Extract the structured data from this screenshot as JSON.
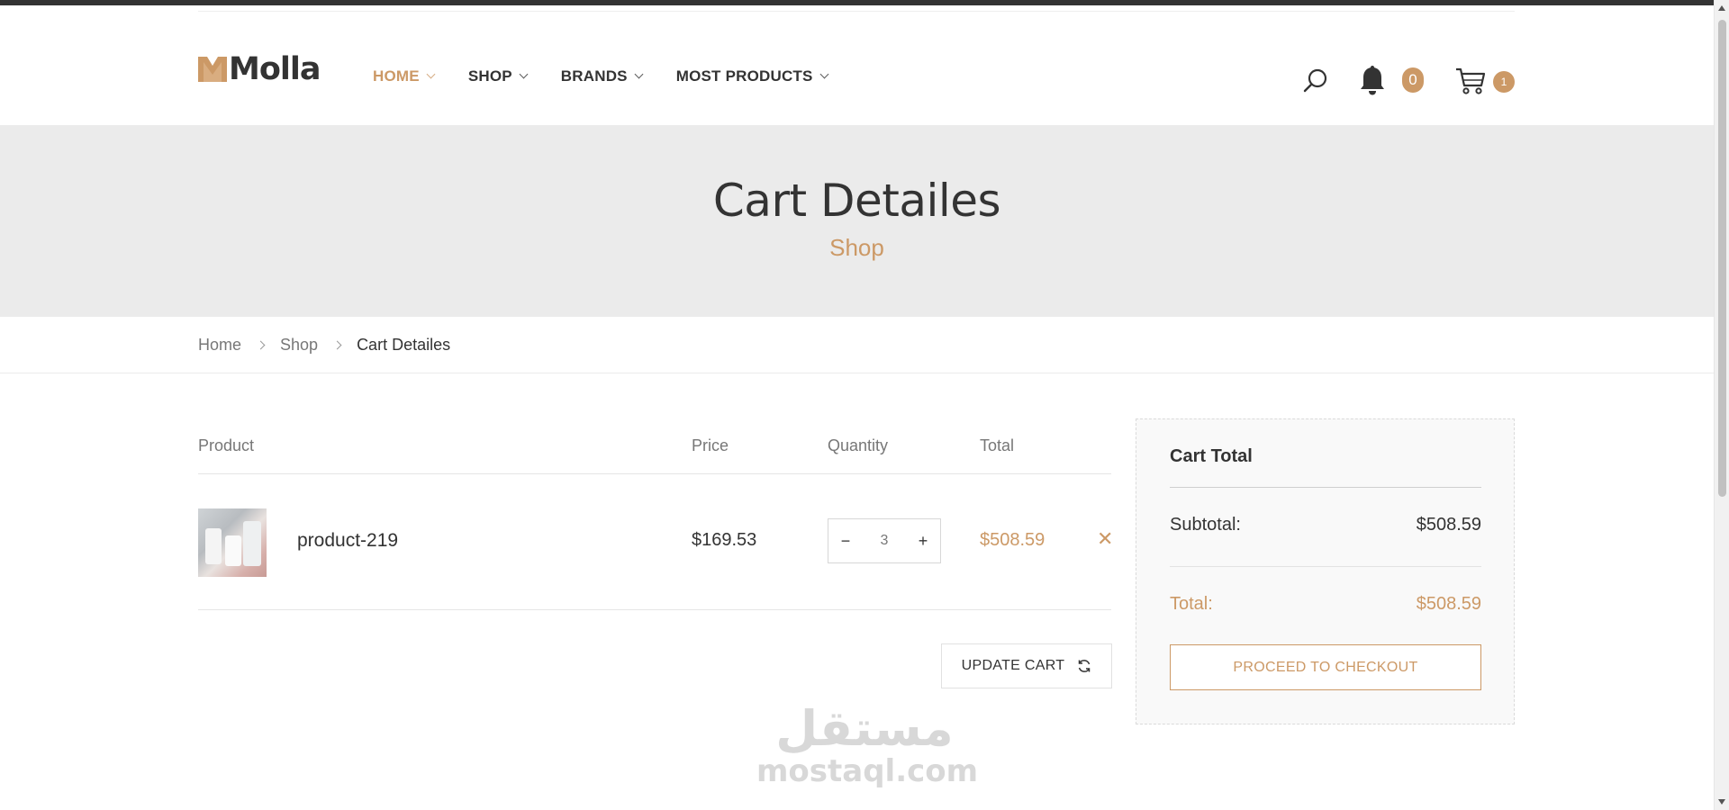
{
  "brand": {
    "name": "Molla",
    "accent_color": "#cc9966"
  },
  "nav": {
    "items": [
      {
        "label": "HOME",
        "active": true
      },
      {
        "label": "SHOP",
        "active": false
      },
      {
        "label": "BRANDS",
        "active": false
      },
      {
        "label": "MOST PRODUCTS",
        "active": false
      }
    ]
  },
  "header_icons": {
    "search": "search-icon",
    "notifications": {
      "icon": "bell-icon",
      "count": "0"
    },
    "cart": {
      "icon": "cart-icon",
      "count": "1"
    }
  },
  "page_header": {
    "title": "Cart Detailes",
    "subtitle": "Shop"
  },
  "breadcrumb": [
    "Home",
    "Shop",
    "Cart Detailes"
  ],
  "cart_table": {
    "headers": {
      "product": "Product",
      "price": "Price",
      "quantity": "Quantity",
      "total": "Total"
    },
    "rows": [
      {
        "name": "product-219",
        "price": "$169.53",
        "quantity": "3",
        "total": "$508.59",
        "thumbnail": "product-image"
      }
    ],
    "qty_minus": "−",
    "qty_plus": "+",
    "remove": "✕"
  },
  "update_button": "UPDATE CART",
  "summary": {
    "title": "Cart Total",
    "subtotal_label": "Subtotal:",
    "subtotal_value": "$508.59",
    "total_label": "Total:",
    "total_value": "$508.59",
    "checkout_button": "PROCEED TO CHECKOUT"
  },
  "watermark": {
    "arabic": "مستقل",
    "latin": "mostaql.com"
  }
}
